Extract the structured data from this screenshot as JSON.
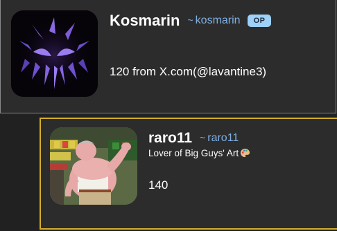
{
  "posts": [
    {
      "display_name": "Kosmarin",
      "handle_prefix": "~",
      "handle": "kosmarin",
      "badge": "OP",
      "body": "120 from X.com(@lavantine3)",
      "border_color": "#8a8a8a"
    },
    {
      "display_name": "raro11",
      "handle_prefix": "~",
      "handle": "raro11",
      "bio": "Lover of Big Guys' Art",
      "bio_icon": "artist-palette-icon",
      "body": "140",
      "border_color": "#d4b02a"
    }
  ],
  "colors": {
    "background": "#212121",
    "card": "#2c2c2c",
    "handle": "#7fb0e3",
    "badge_bg": "#9ed0f8",
    "highlight_border": "#d4b02a"
  }
}
